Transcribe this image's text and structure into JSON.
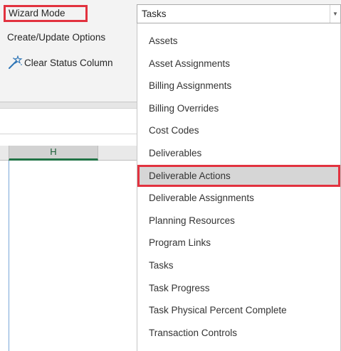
{
  "ribbon": {
    "wizard_mode_label": "Wizard Mode",
    "create_update_label": "Create/Update Options",
    "clear_status_label": "Clear Status Column",
    "wand_icon": "magic-wand-icon",
    "accent_color": "#e2323f"
  },
  "sheet": {
    "column_h": "H"
  },
  "wizard_select": {
    "value": "Tasks",
    "arrow_icon": "chevron-down-icon"
  },
  "dropdown": {
    "selected_index": 6,
    "items": [
      "Assets",
      "Asset Assignments",
      "Billing Assignments",
      "Billing Overrides",
      "Cost Codes",
      "Deliverables",
      "Deliverable Actions",
      "Deliverable Assignments",
      "Planning Resources",
      "Program Links",
      "Tasks",
      "Task Progress",
      "Task Physical Percent Complete",
      "Transaction Controls"
    ]
  }
}
